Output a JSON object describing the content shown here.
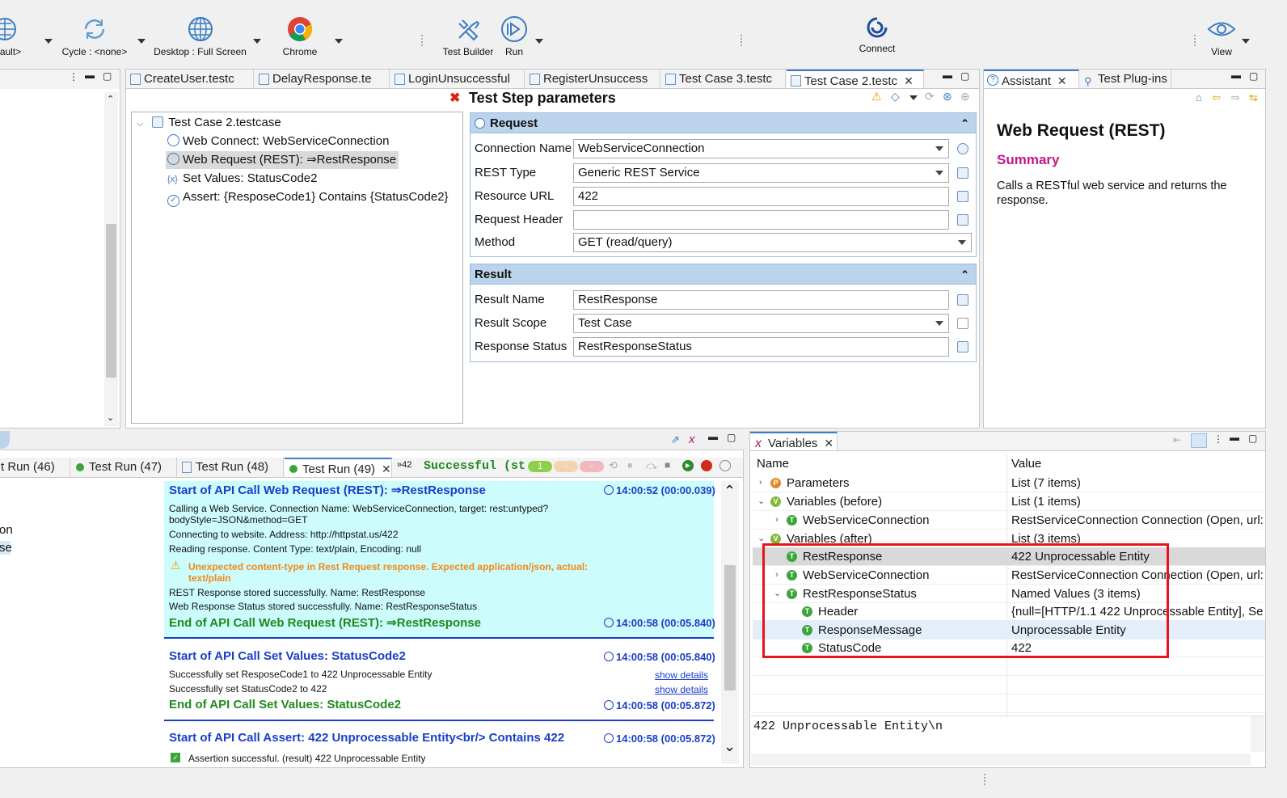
{
  "toolbar": {
    "items": [
      {
        "label": "ault>",
        "icon": "globe-icon"
      },
      {
        "label": "Cycle : <none>",
        "icon": "cycle-icon"
      },
      {
        "label": "Desktop : Full Screen",
        "icon": "globe-icon"
      },
      {
        "label": "Chrome",
        "icon": "chrome-icon"
      },
      {
        "label": "Test Builder",
        "icon": "tools-icon"
      },
      {
        "label": "Run",
        "icon": "play-icon"
      },
      {
        "label": "Connect",
        "icon": "connect-icon"
      },
      {
        "label": "View",
        "icon": "eye-icon"
      }
    ]
  },
  "editor": {
    "tabs": [
      "CreateUser.testc",
      "DelayResponse.te",
      "LoginUnsuccessful",
      "RegisterUnsuccess",
      "Test Case 3.testc",
      "Test Case 2.testc"
    ],
    "tree": {
      "root": "Test Case 2.testcase",
      "items": [
        "Web Connect: WebServiceConnection",
        "Web Request (REST): ⇒RestResponse",
        "Set Values: StatusCode2",
        "Assert: {ResposeCode1} Contains {StatusCode2}"
      ]
    },
    "params_title": "Test Step parameters",
    "request": {
      "heading": "Request",
      "fields": [
        {
          "label": "Connection Name",
          "value": "WebServiceConnection"
        },
        {
          "label": "REST Type",
          "value": "Generic REST Service"
        },
        {
          "label": "Resource URL",
          "value": "422"
        },
        {
          "label": "Request Header",
          "value": ""
        },
        {
          "label": "Method",
          "value": "GET (read/query)"
        }
      ]
    },
    "result": {
      "heading": "Result",
      "fields": [
        {
          "label": "Result Name",
          "value": "RestResponse"
        },
        {
          "label": "Result Scope",
          "value": "Test Case"
        },
        {
          "label": "Response Status",
          "value": "RestResponseStatus"
        }
      ]
    }
  },
  "assistant": {
    "tabs": [
      "Assistant",
      "Test Plug-ins"
    ],
    "title": "Web Request (REST)",
    "summary_heading": "Summary",
    "summary_text": "Calls a RESTful web service and returns the response."
  },
  "runs": {
    "tabs": [
      "t Run (46)",
      "Test Run (47)",
      "Test Run (48)",
      "Test Run (49)"
    ],
    "overflow": "»42",
    "status": "Successful (st",
    "badges": [
      "1",
      "-",
      "-"
    ],
    "left_fragments": [
      "on",
      "se"
    ],
    "log": {
      "b1_title": "Start of API Call Web Request (REST): ⇒RestResponse",
      "b1_time": "14:00:52 (00:00.039)",
      "b1_l1": "Calling a Web Service. Connection Name: WebServiceConnection, target: rest:untyped?",
      "b1_l2": "bodyStyle=JSON&method=GET",
      "b1_l3": "Connecting to website. Address: http://httpstat.us/422",
      "b1_l4": "Reading response. Content Type: text/plain, Encoding: null",
      "b1_warn1": "Unexpected content-type in Rest Request response. Expected application/json, actual:",
      "b1_warn2": "text/plain",
      "b1_l5": "REST Response stored successfully. Name: RestResponse",
      "b1_l6": "Web Response Status stored successfully. Name: RestResponseStatus",
      "b1_end": "End of API Call Web Request (REST): ⇒RestResponse",
      "b1_end_time": "14:00:58 (00:05.840)",
      "b2_title": "Start of API Call Set Values: StatusCode2",
      "b2_time": "14:00:58 (00:05.840)",
      "b2_l1": "Successfully set ResposeCode1 to 422 Unprocessable Entity",
      "b2_l2": "Successfully set StatusCode2 to 422",
      "b2_link": "show details",
      "b2_end": "End of API Call Set Values: StatusCode2",
      "b2_end_time": "14:00:58 (00:05.872)",
      "b3_title": "Start of API Call Assert: 422 Unprocessable Entity<br/> Contains 422",
      "b3_time": "14:00:58 (00:05.872)",
      "b3_l1": "Assertion successful. (result) 422 Unprocessable Entity"
    }
  },
  "variables": {
    "tab": "Variables",
    "col_name": "Name",
    "col_value": "Value",
    "rows": [
      {
        "name": "Parameters",
        "value": "List (7 items)"
      },
      {
        "name": "Variables (before)",
        "value": "List (1 items)"
      },
      {
        "name": "WebServiceConnection",
        "value": "RestServiceConnection Connection (Open, url: ..."
      },
      {
        "name": "Variables (after)",
        "value": "List (3 items)"
      },
      {
        "name": "RestResponse",
        "value": "422 Unprocessable Entity"
      },
      {
        "name": "WebServiceConnection",
        "value": "RestServiceConnection Connection (Open, url: ..."
      },
      {
        "name": "RestResponseStatus",
        "value": "Named Values (3 items)"
      },
      {
        "name": "Header",
        "value": "{null=[HTTP/1.1 422 Unprocessable Entity], Se..."
      },
      {
        "name": "ResponseMessage",
        "value": "Unprocessable Entity"
      },
      {
        "name": "StatusCode",
        "value": "422"
      }
    ],
    "detail": "422 Unprocessable Entity\\n"
  },
  "colors": {
    "highlight": "#e8131b",
    "log_bg": "#ccfcfc",
    "accent": "#3d7bd0"
  }
}
